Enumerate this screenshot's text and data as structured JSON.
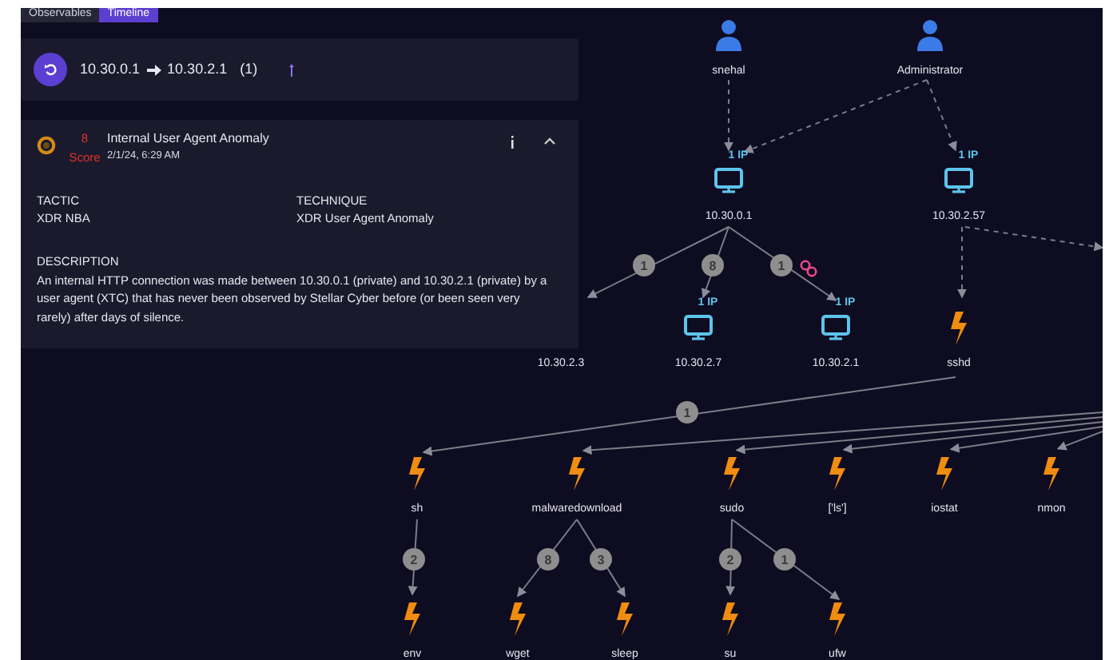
{
  "tabs": [
    {
      "label": "Observables",
      "selected": false
    },
    {
      "label": "Timeline",
      "selected": true
    }
  ],
  "path": {
    "source": "10.30.0.1",
    "target": "10.30.2.1",
    "count": "(1)"
  },
  "alert": {
    "score": "8",
    "score_label": "Score",
    "title": "Internal User Agent Anomaly",
    "time": "2/1/24, 6:29 AM",
    "expanded": true,
    "fields": [
      {
        "label": "TACTIC",
        "value": "XDR NBA"
      },
      {
        "label": "TECHNIQUE",
        "value": "XDR User Agent Anomaly"
      }
    ],
    "description_label": "DESCRIPTION",
    "description": "An internal HTTP connection was made between 10.30.0.1 (private) and 10.30.2.1 (private) by a user agent (XTC) that has never been observed by Stellar Cyber before (or been seen very rarely) after days of silence."
  },
  "graph": {
    "nodes": [
      {
        "kind": "user",
        "label": "snehal"
      },
      {
        "kind": "user",
        "label": "Administrator"
      },
      {
        "kind": "host",
        "label": "10.30.0.1",
        "badge": "1 IP"
      },
      {
        "kind": "host",
        "label": "10.30.2.57",
        "badge": "1 IP"
      },
      {
        "kind": "host",
        "label": "10.30.2.3"
      },
      {
        "kind": "host",
        "label": "10.30.2.7",
        "badge": "1 IP"
      },
      {
        "kind": "host",
        "label": "10.30.2.1",
        "badge": "1 IP",
        "linked": true
      },
      {
        "kind": "process",
        "label": "sshd"
      },
      {
        "kind": "process",
        "label": "sh"
      },
      {
        "kind": "process",
        "label": "malwaredownload"
      },
      {
        "kind": "process",
        "label": "sudo"
      },
      {
        "kind": "process",
        "label": "['ls']"
      },
      {
        "kind": "process",
        "label": "iostat"
      },
      {
        "kind": "process",
        "label": "nmon"
      },
      {
        "kind": "process",
        "label": "env"
      },
      {
        "kind": "process",
        "label": "wget"
      },
      {
        "kind": "process",
        "label": "sleep"
      },
      {
        "kind": "process",
        "label": "su"
      },
      {
        "kind": "process",
        "label": "ufw"
      }
    ],
    "edge_counts": [
      "1",
      "8",
      "1",
      "1",
      "2",
      "8",
      "3",
      "2",
      "1"
    ]
  }
}
